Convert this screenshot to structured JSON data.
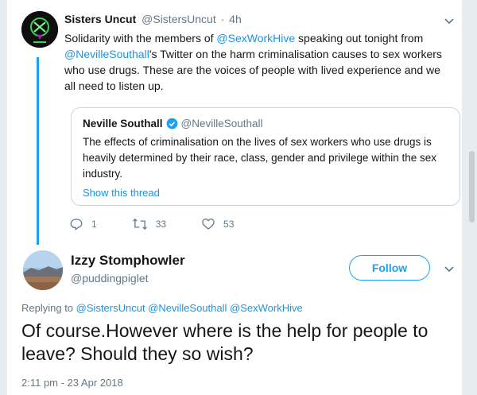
{
  "tweet1": {
    "name": "Sisters Uncut",
    "handle": "@SistersUncut",
    "separator": "·",
    "time": "4h",
    "text_parts": {
      "p1": "Solidarity with the members of ",
      "m1": "@SexWorkHive",
      "p2": " speaking out tonight from ",
      "m2": "@NevilleSouthall",
      "p3": "'s Twitter on the harm criminalisation causes to sex workers who use drugs. These are the voices of people with lived experience and we all need to listen up."
    },
    "quote": {
      "name": "Neville Southall",
      "handle": "@NevilleSouthall",
      "text": "The effects of criminalisation on the lives of sex workers who use drugs is heavily determined by their race, class, gender and privilege within the sex industry.",
      "show_thread": "Show this thread"
    },
    "actions": {
      "replies": "1",
      "retweets": "33",
      "likes": "53"
    }
  },
  "tweet2": {
    "name": "Izzy Stomphowler",
    "handle": "@puddingpiglet",
    "follow_label": "Follow",
    "replying_label": "Replying to",
    "replying_to": [
      "@SistersUncut",
      "@NevilleSouthall",
      "@SexWorkHive"
    ],
    "text": "Of course.However where is the help for people to leave? Should they so wish?",
    "timestamp": "2:11 pm - 23 Apr 2018"
  },
  "colors": {
    "accent": "#1da1f2",
    "link": "#1b95e0",
    "secondary_text": "#657786",
    "border": "#ccd6dd"
  },
  "icons": {
    "reply": "reply-icon",
    "retweet": "retweet-icon",
    "like": "heart-icon",
    "verified": "verified-badge-icon",
    "caret": "chevron-down-icon"
  }
}
